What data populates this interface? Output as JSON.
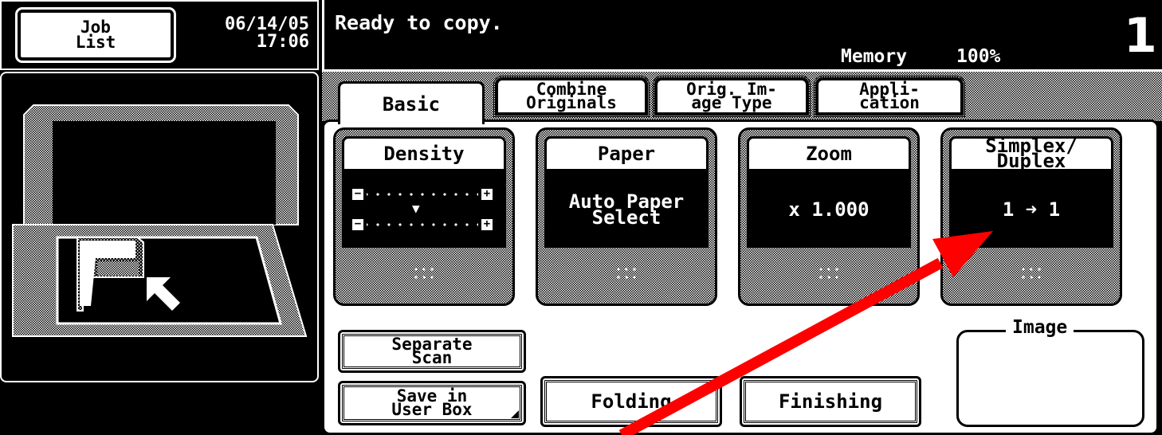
{
  "header": {
    "job_list_label": "Job\nList",
    "date": "06/14/05",
    "time": "17:06",
    "status_message": "Ready to copy.",
    "memory_label": "Memory",
    "memory_value": "100%",
    "copy_count": "1"
  },
  "tabs": [
    {
      "label": "Basic",
      "active": true
    },
    {
      "label": "Combine\nOriginals",
      "active": false
    },
    {
      "label": "Orig. Im-\nage Type",
      "active": false
    },
    {
      "label": "Appli-\ncation",
      "active": false
    }
  ],
  "cards": {
    "density": {
      "title": "Density",
      "level_fraction": 0.45
    },
    "paper": {
      "title": "Paper",
      "value": "Auto Paper\nSelect"
    },
    "zoom": {
      "title": "Zoom",
      "value": "x 1.000"
    },
    "duplex": {
      "title": "Simplex/\nDuplex",
      "value": "1 ➜ 1"
    }
  },
  "buttons": {
    "separate_scan": "Separate\nScan",
    "save_in_user_box": "Save in\nUser Box",
    "folding": "Folding",
    "finishing": "Finishing"
  },
  "image_panel": {
    "label": "Image"
  },
  "colors": {
    "annotation_arrow": "#ff0000",
    "screen_bg": "#000000",
    "panel_bg": "#ffffff"
  }
}
